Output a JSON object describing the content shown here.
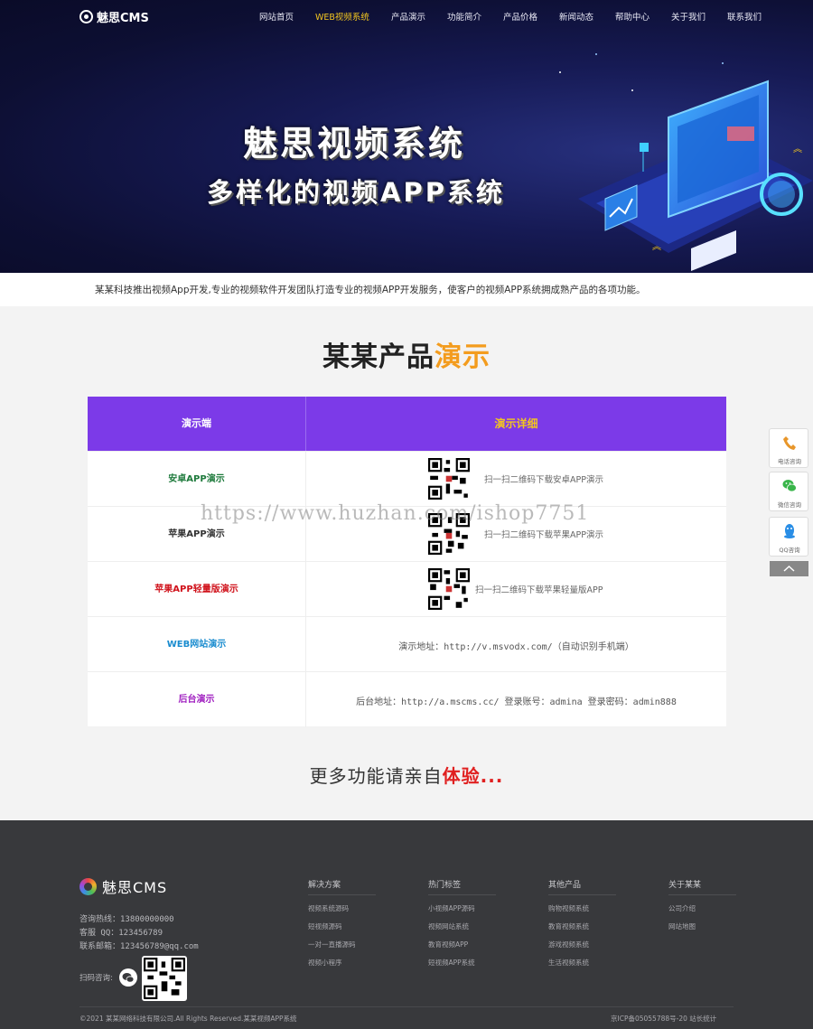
{
  "nav": {
    "logo_text": "魅思CMS",
    "items": [
      {
        "label": "网站首页",
        "active": false
      },
      {
        "label": "WEB视频系统",
        "active": true
      },
      {
        "label": "产品演示",
        "active": false
      },
      {
        "label": "功能简介",
        "active": false
      },
      {
        "label": "产品价格",
        "active": false
      },
      {
        "label": "新闻动态",
        "active": false
      },
      {
        "label": "帮助中心",
        "active": false
      },
      {
        "label": "关于我们",
        "active": false
      },
      {
        "label": "联系我们",
        "active": false
      }
    ],
    "active_color": "#f3c620"
  },
  "hero": {
    "title": "魅思视频系统",
    "subtitle": "多样化的视频APP系统"
  },
  "intro": {
    "text": "某某科技推出视频App开发,专业的视频软件开发团队打造专业的视频APP开发服务，使客户的视频APP系统拥成熟产品的各项功能。"
  },
  "section": {
    "title_main": "某某产品",
    "title_highlight": "演示"
  },
  "demo_table": {
    "header_color": "#7c3ae8",
    "col1": "演示端",
    "col2": "演示详细",
    "rows": [
      {
        "label": "安卓APP演示",
        "color": "#1e7a3c",
        "detail": "扫一扫二维码下载安卓APP演示"
      },
      {
        "label": "苹果APP演示",
        "color": "#333333",
        "detail": "扫一扫二维码下载苹果APP演示"
      },
      {
        "label": "苹果APP轻量版演示",
        "color": "#d0121b",
        "detail": "扫一扫二维码下载苹果轻量版APP"
      },
      {
        "label": "WEB网站演示",
        "color": "#1a8ccf",
        "detail": "演示地址：http://v.msvodx.com/（自动识别手机端）"
      },
      {
        "label": "后台演示",
        "color": "#a020c0",
        "detail": "后台地址：http://a.mscms.cc/   登录账号：admina   登录密码：admin888"
      }
    ]
  },
  "watermark": "https://www.huzhan.com/ishop7751",
  "more": {
    "text": "更多功能请亲自",
    "highlight": "体验..."
  },
  "side_float": [
    {
      "label": "电话咨询",
      "icon": "phone-icon"
    },
    {
      "label": "微信咨询",
      "icon": "wechat-icon"
    },
    {
      "label": "QQ咨询",
      "icon": "qq-icon"
    }
  ],
  "footer": {
    "logo_text": "魅思CMS",
    "hotline": "咨询热线：13800000000",
    "qq": "客服 QQ：123456789",
    "email": "联系邮箱：123456789@qq.com",
    "scan_label": "扫码咨询:",
    "columns": [
      {
        "title": "解决方案",
        "links": [
          "视频系统源码",
          "短视频源码",
          "一对一直播源码",
          "视频小程序"
        ]
      },
      {
        "title": "热门标签",
        "links": [
          "小视频APP源码",
          "视频网站系统",
          "教育视频APP",
          "短视频APP系统"
        ]
      },
      {
        "title": "其他产品",
        "links": [
          "购物视频系统",
          "教育视频系统",
          "游戏视频系统",
          "生活视频系统"
        ]
      },
      {
        "title": "关于某某",
        "links": [
          "公司介绍",
          "网站地图"
        ]
      }
    ],
    "copyright": "©2021 某某网络科技有限公司.All Rights Reserved.某某视频APP系统",
    "icp": "京ICP备05055788号-20   站长统计"
  }
}
